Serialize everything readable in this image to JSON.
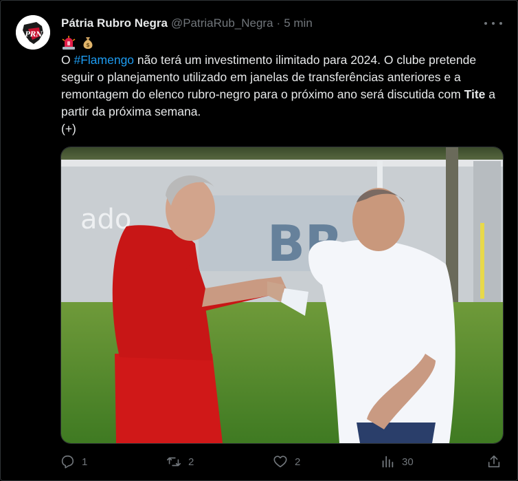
{
  "tweet": {
    "author": {
      "name": "Pátria Rubro Negra",
      "handle": "@PatriaRub_Negra",
      "separator": "·",
      "time": "5 min",
      "avatar_text": "PRN"
    },
    "emojis": [
      "rotating-light-icon",
      "money-bag-icon"
    ],
    "body": {
      "part1": "O ",
      "hashtag": "#Flamengo",
      "part2": " não terá um investimento ilimitado para 2024. O clube pretende seguir o planejamento utilizado em janelas de transferências anteriores e a remontagem do elenco rubro-negro para o próximo ano será discutida com ",
      "mention_bold": "Tite",
      "part3": " a partir da próxima semana.",
      "line2": "(+)"
    },
    "media": {
      "sign_text_left": "ado",
      "sign_text_right": "BR"
    },
    "actions": {
      "replies": "1",
      "retweets": "2",
      "likes": "2",
      "views": "30"
    }
  },
  "colors": {
    "background": "#000000",
    "text": "#e7e9ea",
    "muted": "#71767b",
    "link": "#1d9bf0",
    "border": "#2f3336"
  }
}
